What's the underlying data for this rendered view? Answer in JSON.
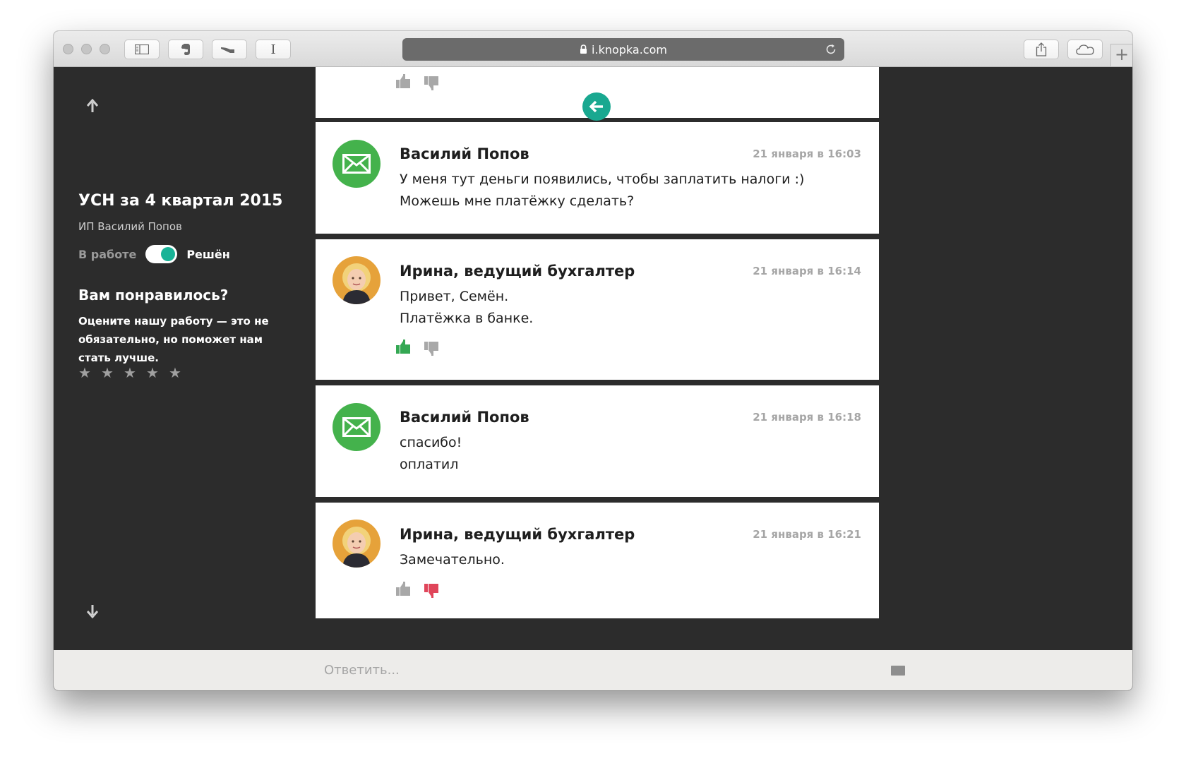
{
  "browser": {
    "url": "i.knopka.com",
    "new_tab_label": "+"
  },
  "sidebar": {
    "case_title": "УСН за 4 квартал 2015",
    "client": "ИП Василий Попов",
    "status_off": "В работе",
    "status_on": "Решён",
    "status_resolved": true,
    "rating_title": "Вам понравилось?",
    "rating_text": "Оцените нашу работу — это не обязательно, но поможет нам стать лучше.",
    "stars": [
      "★",
      "★",
      "★",
      "★",
      "★"
    ]
  },
  "messages": [
    {
      "sender": "Василий Попов",
      "time": "21 января в 16:03",
      "lines": [
        "У меня тут деньги появились, чтобы заплатить налоги :)",
        "Можешь мне платёжку сделать?"
      ],
      "avatar": "mail-icon"
    },
    {
      "sender": "Ирина, ведущий бухгалтер",
      "time": "21 января в 16:14",
      "lines": [
        "Привет, Семён.",
        "Платёжка в банке."
      ],
      "avatar": "photo",
      "vote": "up"
    },
    {
      "sender": "Василий Попов",
      "time": "21 января в 16:18",
      "lines": [
        "спасибо!",
        "оплатил"
      ],
      "avatar": "mail-icon"
    },
    {
      "sender": "Ирина, ведущий бухгалтер",
      "time": "21 января в 16:21",
      "lines": [
        "Замечательно."
      ],
      "avatar": "photo",
      "vote": "down"
    }
  ],
  "reply": {
    "placeholder": "Ответить..."
  },
  "colors": {
    "accent": "#19b397",
    "mail_green": "#44b24c",
    "vote_up": "#34a853",
    "vote_down": "#e0455a",
    "vote_neutral": "#a8a8a8",
    "sidebar_bg": "#2c2c2c"
  }
}
